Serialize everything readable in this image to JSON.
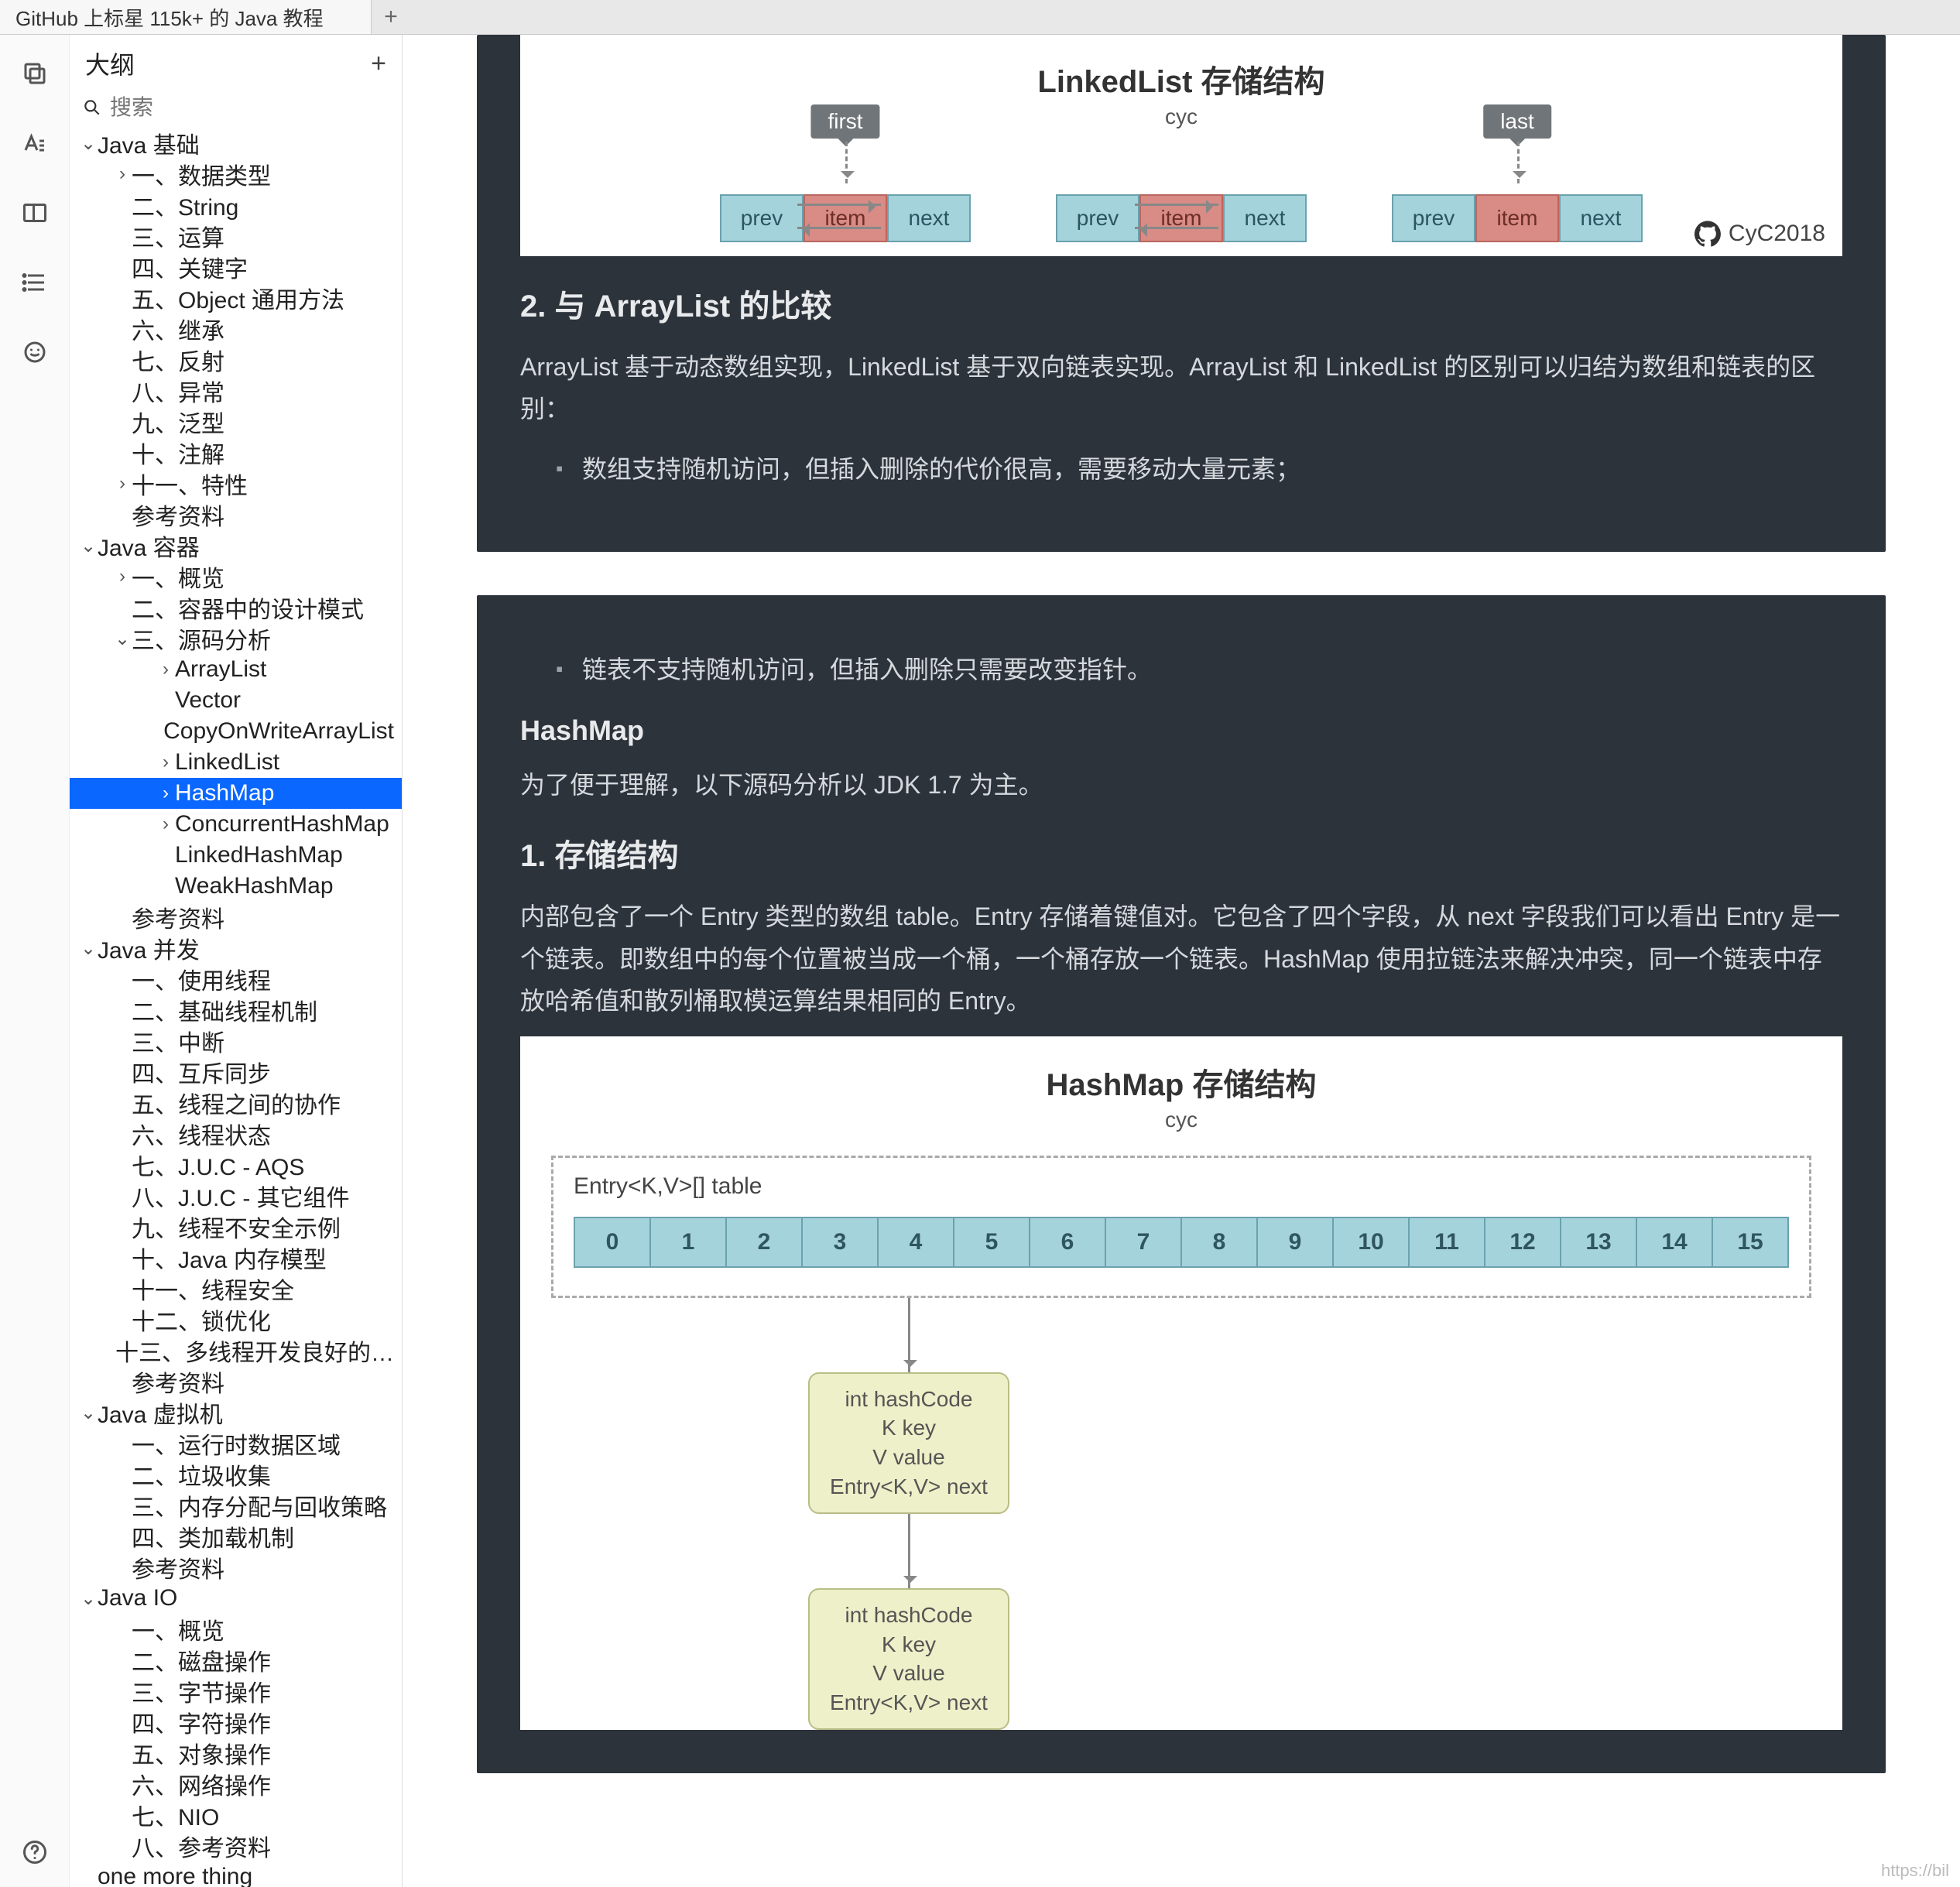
{
  "tab_title": "GitHub 上标星 115k+ 的 Java 教程",
  "sidebar": {
    "title": "大纲",
    "search_placeholder": "搜索",
    "tree": [
      {
        "d": 0,
        "c": "v",
        "t": "Java 基础"
      },
      {
        "d": 1,
        "c": ">",
        "t": "一、数据类型"
      },
      {
        "d": 1,
        "c": "",
        "t": "二、String"
      },
      {
        "d": 1,
        "c": "",
        "t": "三、运算"
      },
      {
        "d": 1,
        "c": "",
        "t": "四、关键字"
      },
      {
        "d": 1,
        "c": "",
        "t": "五、Object 通用方法"
      },
      {
        "d": 1,
        "c": "",
        "t": "六、继承"
      },
      {
        "d": 1,
        "c": "",
        "t": "七、反射"
      },
      {
        "d": 1,
        "c": "",
        "t": "八、异常"
      },
      {
        "d": 1,
        "c": "",
        "t": "九、泛型"
      },
      {
        "d": 1,
        "c": "",
        "t": "十、注解"
      },
      {
        "d": 1,
        "c": ">",
        "t": "十一、特性"
      },
      {
        "d": 1,
        "c": "",
        "t": "参考资料"
      },
      {
        "d": 0,
        "c": "v",
        "t": "Java 容器"
      },
      {
        "d": 1,
        "c": ">",
        "t": "一、概览"
      },
      {
        "d": 1,
        "c": "",
        "t": "二、容器中的设计模式"
      },
      {
        "d": 1,
        "c": "v",
        "t": "三、源码分析"
      },
      {
        "d": 2,
        "c": ">",
        "t": "ArrayList"
      },
      {
        "d": 2,
        "c": "",
        "t": "Vector"
      },
      {
        "d": 2,
        "c": "",
        "t": "CopyOnWriteArrayList"
      },
      {
        "d": 2,
        "c": ">",
        "t": "LinkedList"
      },
      {
        "d": 2,
        "c": ">",
        "t": "HashMap",
        "sel": true
      },
      {
        "d": 2,
        "c": ">",
        "t": "ConcurrentHashMap"
      },
      {
        "d": 2,
        "c": "",
        "t": "LinkedHashMap"
      },
      {
        "d": 2,
        "c": "",
        "t": "WeakHashMap"
      },
      {
        "d": 1,
        "c": "",
        "t": "参考资料"
      },
      {
        "d": 0,
        "c": "v",
        "t": "Java 并发"
      },
      {
        "d": 1,
        "c": "",
        "t": "一、使用线程"
      },
      {
        "d": 1,
        "c": "",
        "t": "二、基础线程机制"
      },
      {
        "d": 1,
        "c": "",
        "t": "三、中断"
      },
      {
        "d": 1,
        "c": "",
        "t": "四、互斥同步"
      },
      {
        "d": 1,
        "c": "",
        "t": "五、线程之间的协作"
      },
      {
        "d": 1,
        "c": "",
        "t": "六、线程状态"
      },
      {
        "d": 1,
        "c": "",
        "t": "七、J.U.C - AQS"
      },
      {
        "d": 1,
        "c": "",
        "t": "八、J.U.C - 其它组件"
      },
      {
        "d": 1,
        "c": "",
        "t": "九、线程不安全示例"
      },
      {
        "d": 1,
        "c": "",
        "t": "十、Java 内存模型"
      },
      {
        "d": 1,
        "c": "",
        "t": "十一、线程安全"
      },
      {
        "d": 1,
        "c": "",
        "t": "十二、锁优化"
      },
      {
        "d": 1,
        "c": "",
        "t": "十三、多线程开发良好的…"
      },
      {
        "d": 1,
        "c": "",
        "t": "参考资料"
      },
      {
        "d": 0,
        "c": "v",
        "t": "Java 虚拟机"
      },
      {
        "d": 1,
        "c": "",
        "t": "一、运行时数据区域"
      },
      {
        "d": 1,
        "c": "",
        "t": "二、垃圾收集"
      },
      {
        "d": 1,
        "c": "",
        "t": "三、内存分配与回收策略"
      },
      {
        "d": 1,
        "c": "",
        "t": "四、类加载机制"
      },
      {
        "d": 1,
        "c": "",
        "t": "参考资料"
      },
      {
        "d": 0,
        "c": "v",
        "t": "Java IO"
      },
      {
        "d": 1,
        "c": "",
        "t": "一、概览"
      },
      {
        "d": 1,
        "c": "",
        "t": "二、磁盘操作"
      },
      {
        "d": 1,
        "c": "",
        "t": "三、字节操作"
      },
      {
        "d": 1,
        "c": "",
        "t": "四、字符操作"
      },
      {
        "d": 1,
        "c": "",
        "t": "五、对象操作"
      },
      {
        "d": 1,
        "c": "",
        "t": "六、网络操作"
      },
      {
        "d": 1,
        "c": "",
        "t": "七、NIO"
      },
      {
        "d": 1,
        "c": "",
        "t": "八、参考资料"
      },
      {
        "d": 0,
        "c": "",
        "t": "one more thing"
      }
    ]
  },
  "content": {
    "ll": {
      "title": "LinkedList 存储结构",
      "sub": "cyc",
      "tag_first": "first",
      "tag_last": "last",
      "cells": [
        "prev",
        "item",
        "next"
      ],
      "badge": "CyC2018"
    },
    "sec2_h": "2. 与 ArrayList 的比较",
    "sec2_p": "ArrayList 基于动态数组实现，LinkedList 基于双向链表实现。ArrayList 和 LinkedList 的区别可以归结为数组和链表的区别：",
    "sec2_li": "数组支持随机访问，但插入删除的代价很高，需要移动大量元素；",
    "card2_li": "链表不支持随机访问，但插入删除只需要改变指针。",
    "hm_h": "HashMap",
    "hm_p1": "为了便于理解，以下源码分析以 JDK 1.7 为主。",
    "hm_h2": "1. 存储结构",
    "hm_p2": "内部包含了一个 Entry 类型的数组 table。Entry 存储着键值对。它包含了四个字段，从 next 字段我们可以看出 Entry 是一个链表。即数组中的每个位置被当成一个桶，一个桶存放一个链表。HashMap 使用拉链法来解决冲突，同一个链表中存放哈希值和散列桶取模运算结果相同的 Entry。",
    "hm_diagram": {
      "title": "HashMap 存储结构",
      "sub": "cyc",
      "label": "Entry<K,V>[] table",
      "entry_lines": [
        "int hashCode",
        "K key",
        "V value",
        "Entry<K,V> next"
      ]
    }
  },
  "status_url": "https://bil"
}
